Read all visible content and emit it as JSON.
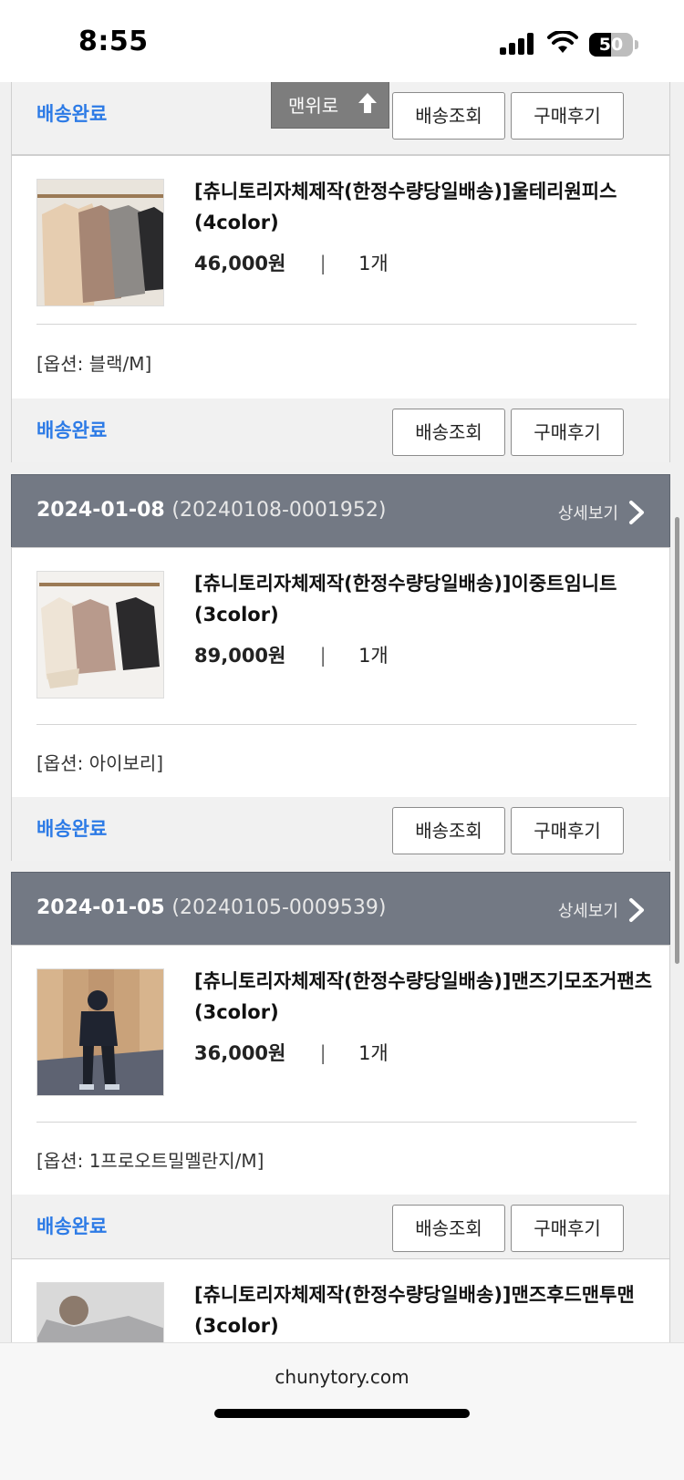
{
  "status_bar": {
    "time": "8:55",
    "battery": "50",
    "battery_level": 0.5
  },
  "to_top": {
    "label": "맨위로"
  },
  "labels": {
    "delivered": "배송완료",
    "track_button": "배송조회",
    "review_button": "구매후기",
    "detail_link": "상세보기",
    "currency_sep": "|"
  },
  "items": [
    {
      "name": "[츄니토리자체제작(한정수량당일배송)]울테리원피스(4color)",
      "price": "46,000원",
      "qty": "1개",
      "option": "[옵션: 블랙/M]"
    },
    {
      "order_date": "2024-01-08",
      "order_no": "(20240108-0001952)",
      "name": "[츄니토리자체제작(한정수량당일배송)]이중트임니트(3color)",
      "price": "89,000원",
      "qty": "1개",
      "option": "[옵션: 아이보리]"
    },
    {
      "order_date": "2024-01-05",
      "order_no": "(20240105-0009539)",
      "name": "[츄니토리자체제작(한정수량당일배송)]맨즈기모조거팬츠(3color)",
      "price": "36,000원",
      "qty": "1개",
      "option": "[옵션: 1프로오트밀멜란지/M]"
    },
    {
      "name": "[츄니토리자체제작(한정수량당일배송)]맨즈후드맨투맨(3color)"
    }
  ],
  "browser": {
    "url": "chunytory.com"
  },
  "colors": {
    "accent": "#2d7be6",
    "header": "#737984"
  }
}
